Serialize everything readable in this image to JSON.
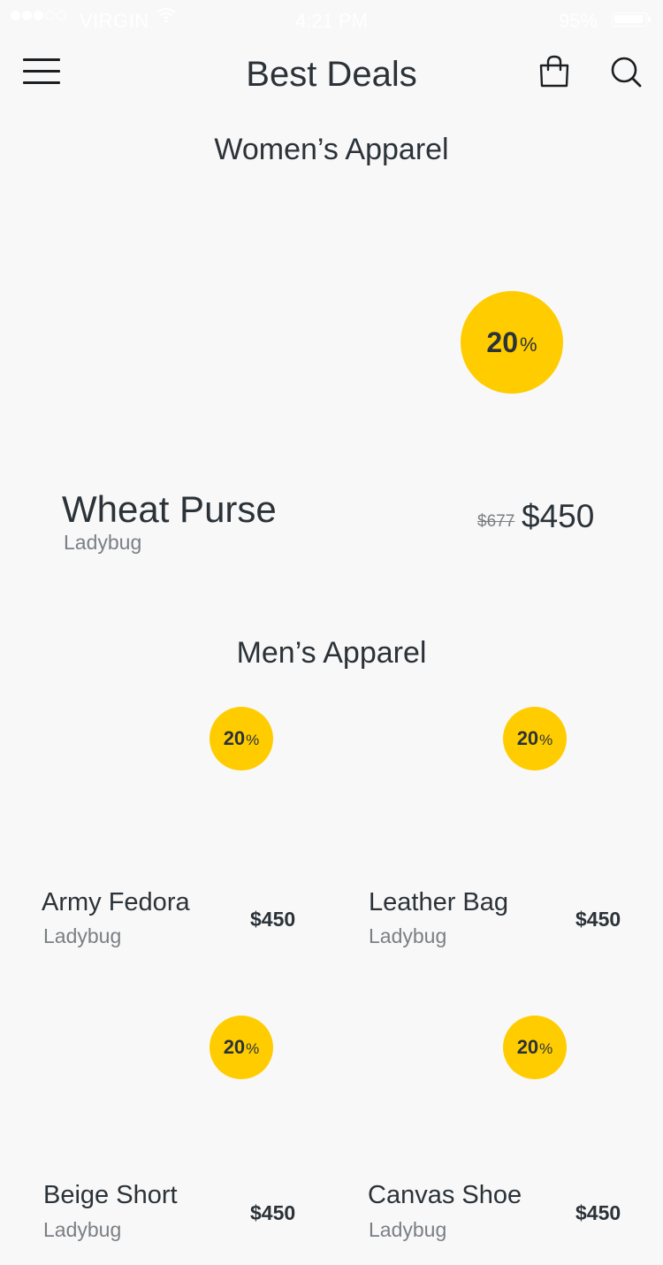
{
  "status_bar": {
    "carrier": "VIRGIN",
    "time": "4:21 PM",
    "battery": "95%",
    "signal_icon": "signal-dots-icon",
    "wifi_icon": "wifi-icon",
    "battery_icon": "battery-icon"
  },
  "header": {
    "title": "Best Deals",
    "menu_icon": "hamburger-menu-icon",
    "bag_icon": "shopping-bag-icon",
    "search_icon": "search-icon"
  },
  "womens": {
    "title": "Women’s Apparel",
    "featured": {
      "discount_value": "20",
      "discount_unit": "%",
      "name": "Wheat Purse",
      "brand": "Ladybug",
      "old_price": "$677",
      "price": "$450"
    }
  },
  "mens": {
    "title": "Men’s Apparel",
    "items": [
      {
        "discount_value": "20",
        "discount_unit": "%",
        "name": "Army Fedora",
        "brand": "Ladybug",
        "price": "$450"
      },
      {
        "discount_value": "20",
        "discount_unit": "%",
        "name": "Leather Bag",
        "brand": "Ladybug",
        "price": "$450"
      },
      {
        "discount_value": "20",
        "discount_unit": "%",
        "name": "Beige Short",
        "brand": "Ladybug",
        "price": "$450"
      },
      {
        "discount_value": "20",
        "discount_unit": "%",
        "name": "Canvas Shoe",
        "brand": "Ladybug",
        "price": "$450"
      }
    ]
  },
  "colors": {
    "accent": "#ffcc00",
    "background": "#f8f8f8",
    "text": "#2b3238",
    "muted": "#7b7f83"
  }
}
